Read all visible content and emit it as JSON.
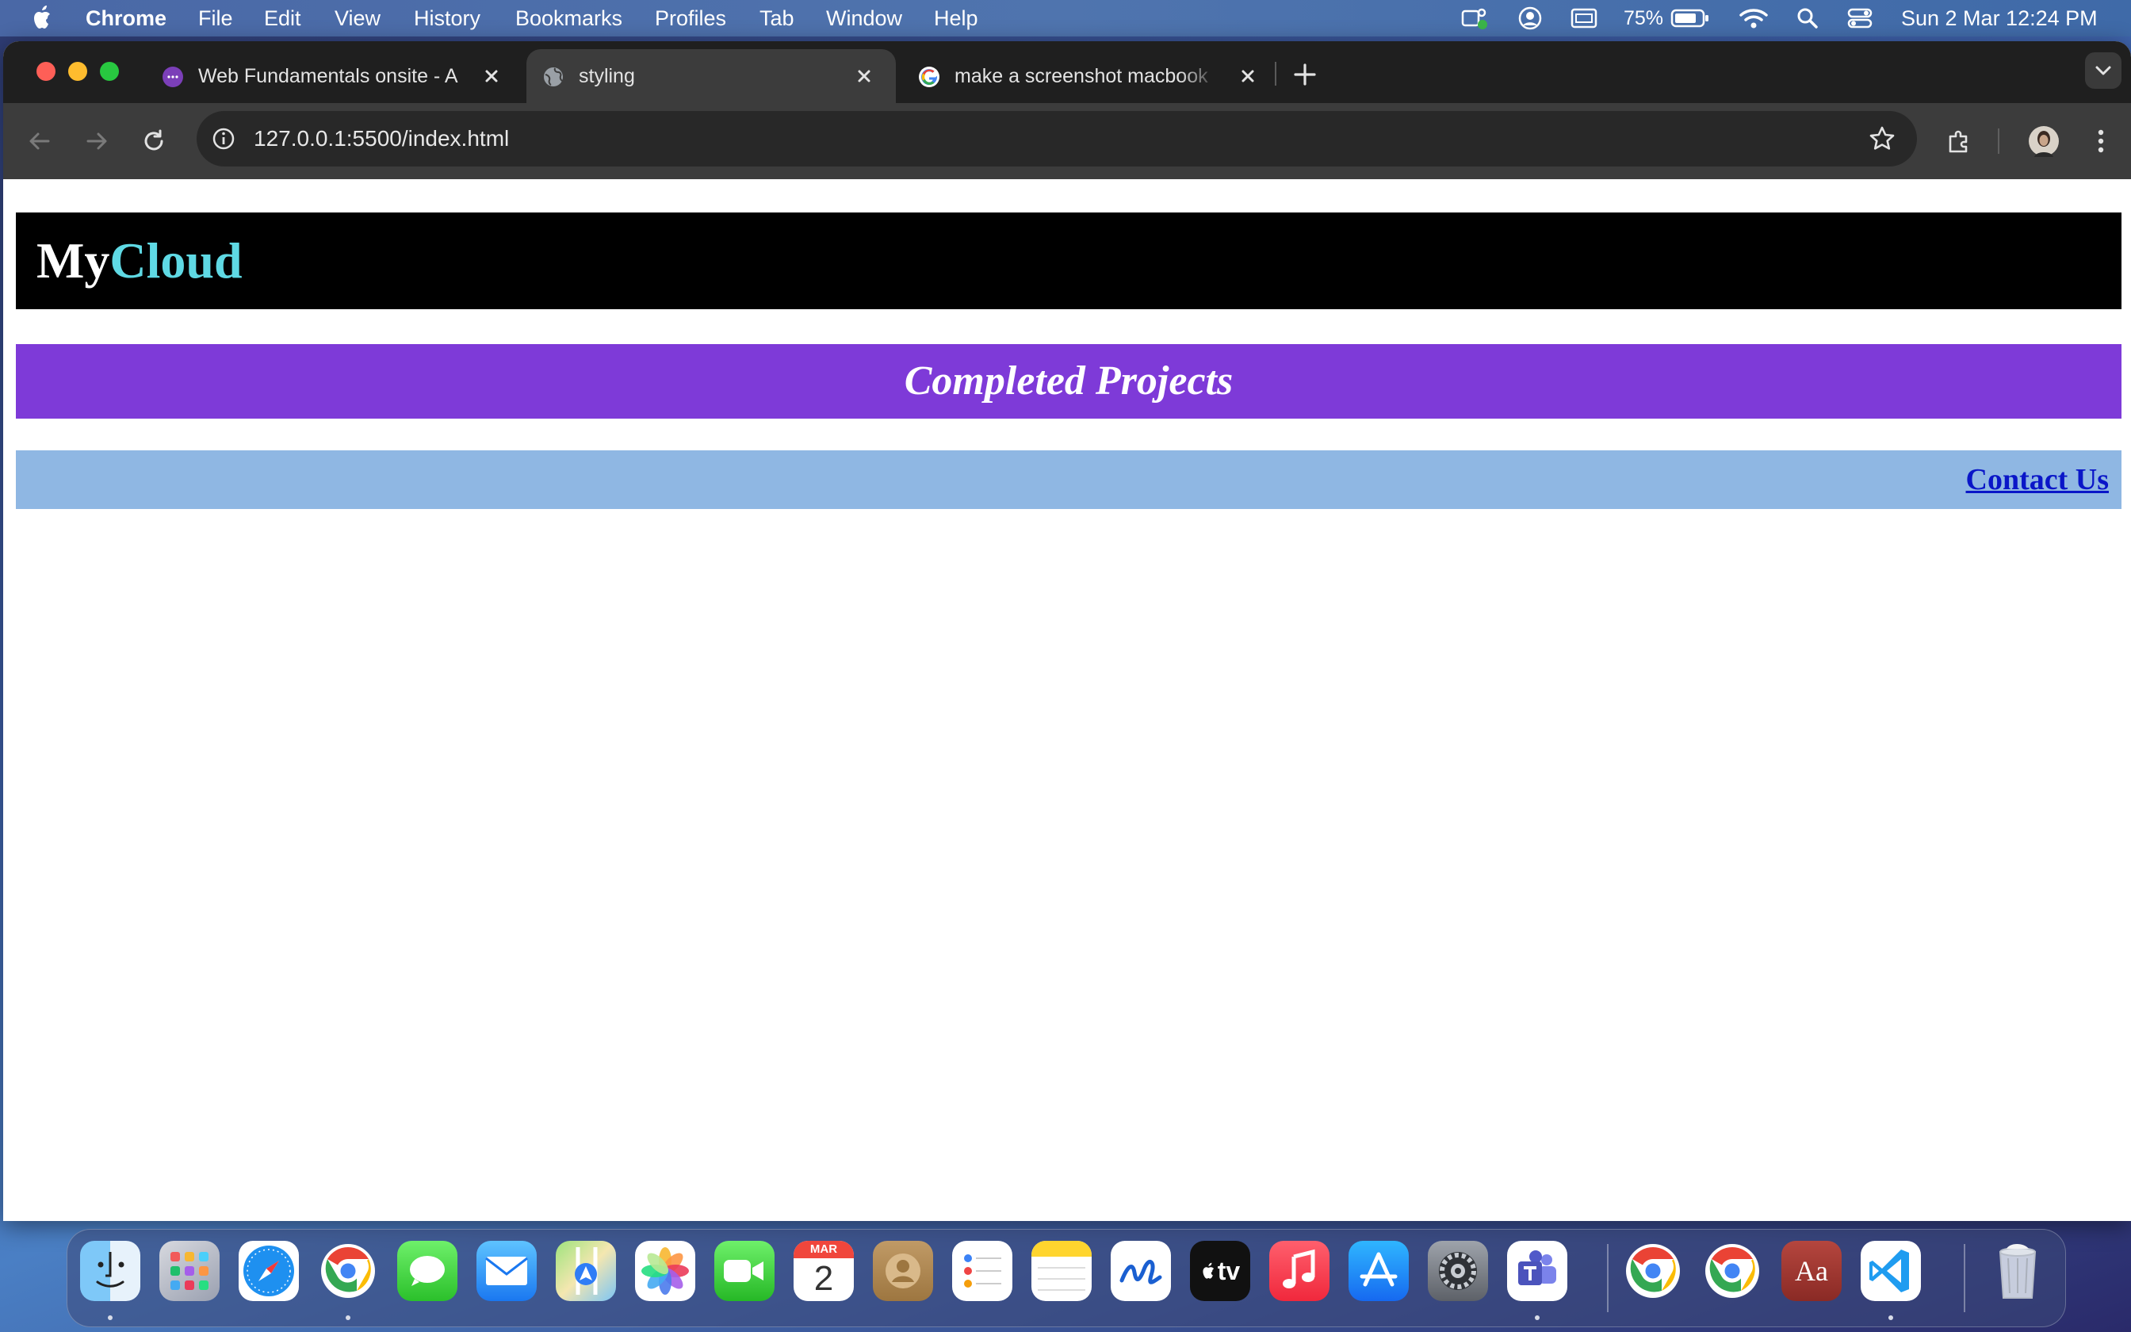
{
  "menubar": {
    "app_name": "Chrome",
    "items": [
      "File",
      "Edit",
      "View",
      "History",
      "Bookmarks",
      "Profiles",
      "Tab",
      "Window",
      "Help"
    ],
    "battery_percent": "75%",
    "datetime": "Sun 2 Mar  12:24 PM"
  },
  "tabs": [
    {
      "title": "Web Fundamentals onsite - A",
      "favicon": "purple-dots-icon",
      "active": false
    },
    {
      "title": "styling",
      "favicon": "globe-icon",
      "active": true
    },
    {
      "title": "make a screenshot macbook",
      "favicon": "google-icon",
      "active": false
    }
  ],
  "toolbar": {
    "url": "127.0.0.1:5500/index.html"
  },
  "page": {
    "logo_part1": "My",
    "logo_part2": "Cloud",
    "projects_heading": "Completed Projects",
    "contact_link": "Contact Us"
  },
  "colors": {
    "header_bg": "#000000",
    "logo_accent": "#5fd9e4",
    "projects_bg": "#7e3ad8",
    "contact_bg": "#8fb7e3",
    "link": "#0a16c8"
  },
  "dock": {
    "apps": [
      "finder-icon",
      "launchpad-icon",
      "safari-icon",
      "chrome-icon",
      "messages-icon",
      "mail-icon",
      "maps-icon",
      "photos-icon",
      "facetime-icon",
      "calendar-icon",
      "contacts-icon",
      "reminders-icon",
      "notes-icon",
      "freeform-icon",
      "tv-icon",
      "music-icon",
      "app-store-icon",
      "system-settings-icon",
      "teams-icon",
      "chrome-icon",
      "chrome-icon",
      "dictionary-icon",
      "vscode-icon",
      "trash-icon"
    ],
    "calendar_month": "MAR",
    "calendar_day": "2",
    "tv_label": "tv",
    "dictionary_label": "Aa"
  }
}
